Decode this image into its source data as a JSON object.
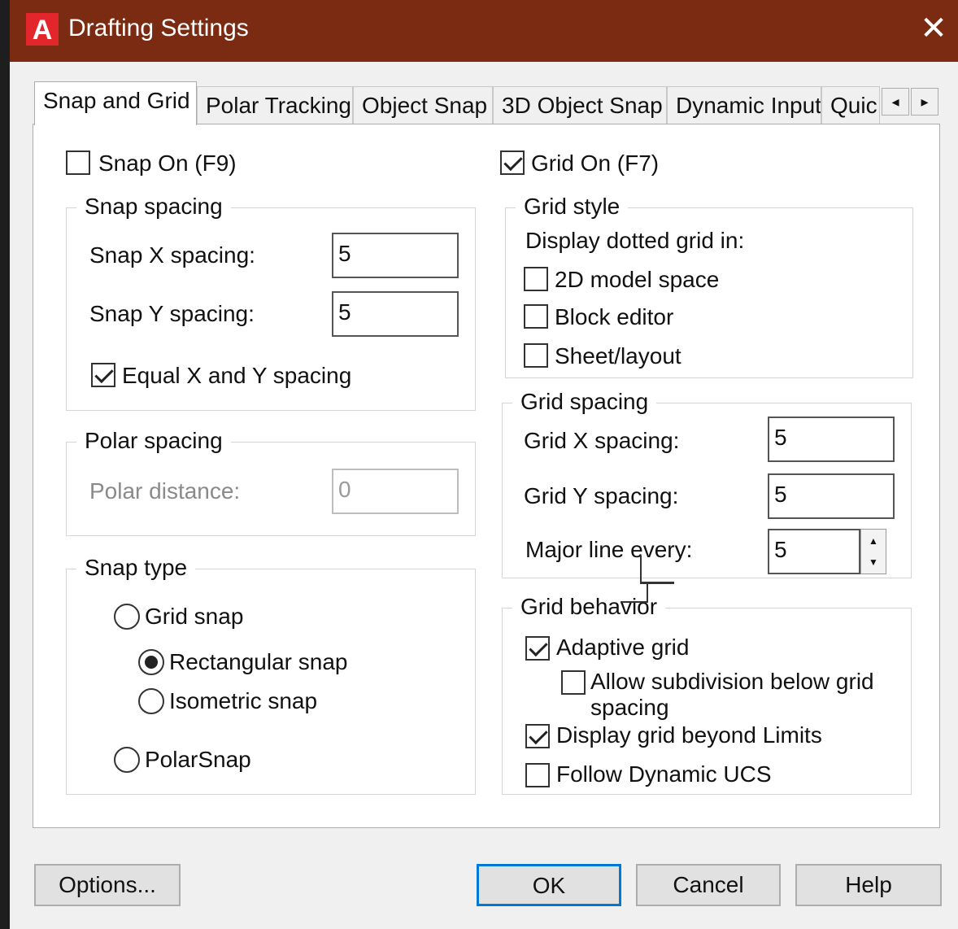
{
  "window": {
    "title": "Drafting Settings",
    "app_icon_letter": "A",
    "close_glyph": "✕"
  },
  "tabs": [
    {
      "label": "Snap and Grid",
      "active": true
    },
    {
      "label": "Polar Tracking"
    },
    {
      "label": "Object Snap"
    },
    {
      "label": "3D Object Snap"
    },
    {
      "label": "Dynamic Input"
    },
    {
      "label": "Quic"
    }
  ],
  "tab_scroll": {
    "left": "◂",
    "right": "▸"
  },
  "snap": {
    "snap_on_label": "Snap On (F9)",
    "snap_on_checked": false,
    "spacing_group": "Snap spacing",
    "x_label": "Snap X spacing:",
    "x_value": "5",
    "y_label": "Snap Y spacing:",
    "y_value": "5",
    "equal_label": "Equal X and Y spacing",
    "equal_checked": true
  },
  "polar": {
    "group": "Polar spacing",
    "distance_label": "Polar distance:",
    "distance_value": "0"
  },
  "snap_type": {
    "group": "Snap type",
    "grid_snap": "Grid snap",
    "rectangular": "Rectangular snap",
    "isometric": "Isometric snap",
    "polarsnap": "PolarSnap",
    "selected": "rectangular"
  },
  "grid": {
    "grid_on_label": "Grid On (F7)",
    "grid_on_checked": true,
    "style_group": "Grid style",
    "display_dotted": "Display dotted grid in:",
    "model_space": "2D model space",
    "block_editor": "Block editor",
    "sheet_layout": "Sheet/layout",
    "spacing_group": "Grid spacing",
    "x_label": "Grid X spacing:",
    "x_value": "5",
    "y_label": "Grid Y spacing:",
    "y_value": "5",
    "major_label": "Major line every:",
    "major_value": "5",
    "behavior_group": "Grid behavior",
    "adaptive": "Adaptive grid",
    "subdivision_line1": "Allow subdivision below grid",
    "subdivision_line2": "spacing",
    "beyond_limits": "Display grid beyond Limits",
    "follow_ucs": "Follow Dynamic UCS"
  },
  "buttons": {
    "options": "Options...",
    "ok": "OK",
    "cancel": "Cancel",
    "help": "Help"
  },
  "icons": {
    "spin_up": "▲",
    "spin_down": "▼"
  }
}
